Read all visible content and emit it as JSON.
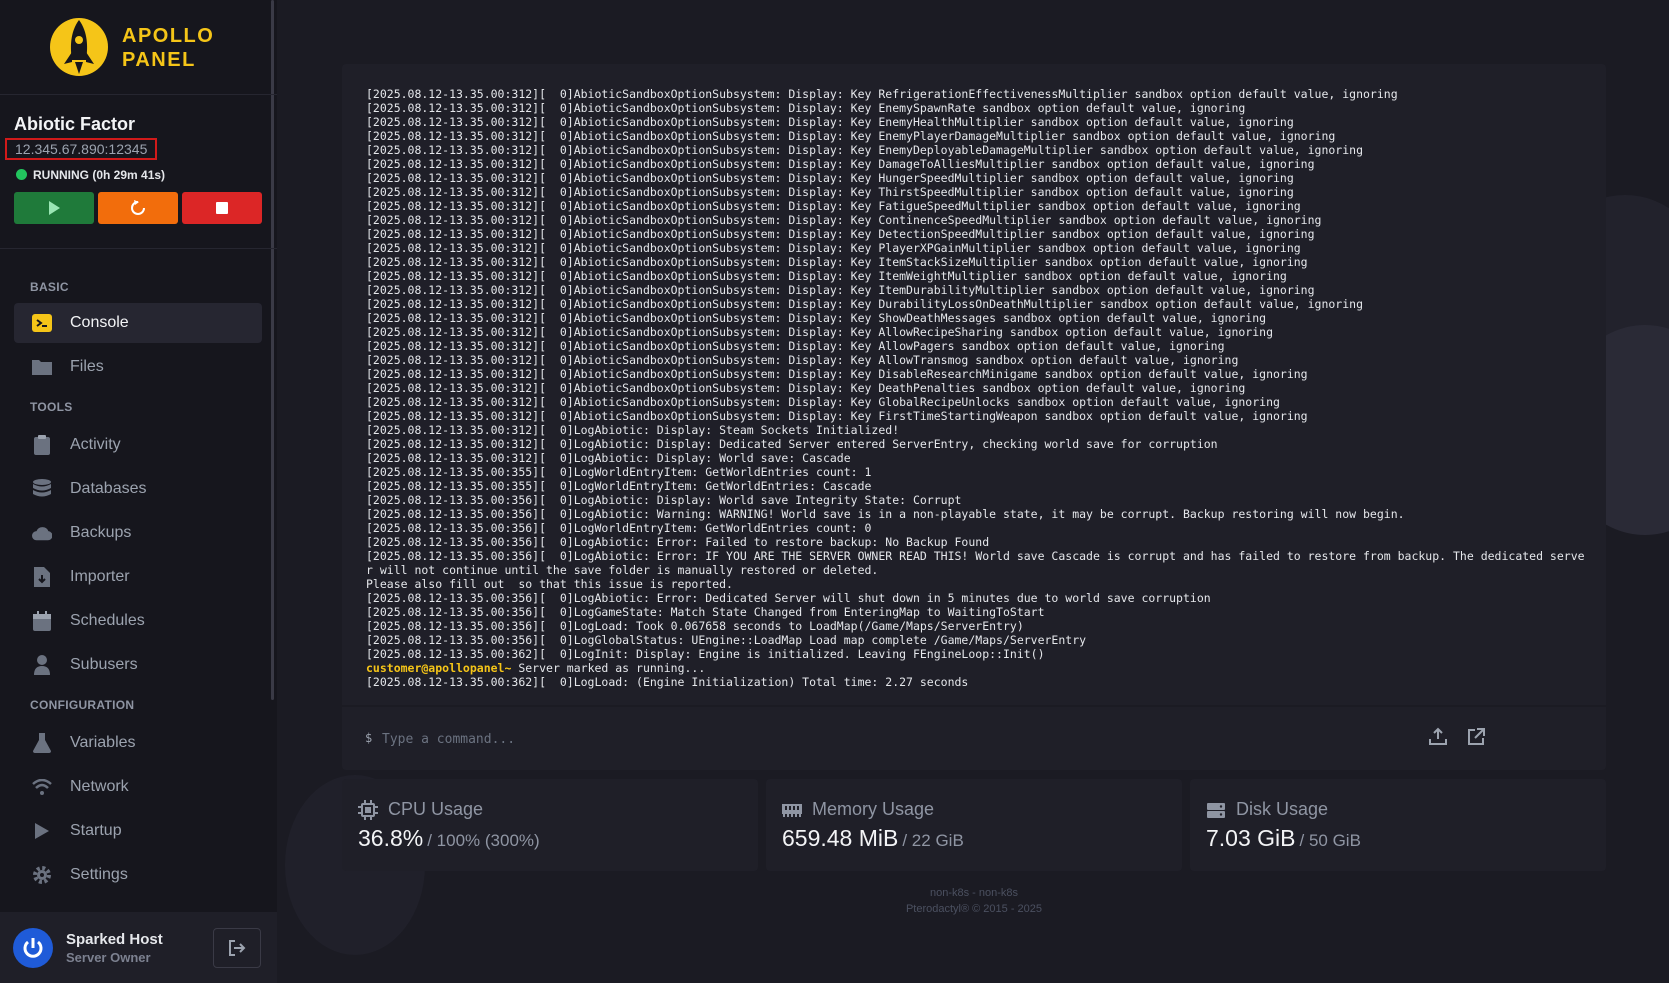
{
  "brand": {
    "line1": "APOLLO",
    "line2": "PANEL"
  },
  "server": {
    "name": "Abiotic Factor",
    "address": "12.345.67.890:12345",
    "status": "RUNNING (0h 29m 41s)"
  },
  "power_buttons": {
    "start": "play-icon",
    "restart": "restart-icon",
    "stop": "stop-icon"
  },
  "nav": {
    "basic_label": "BASIC",
    "tools_label": "TOOLS",
    "config_label": "CONFIGURATION",
    "items": [
      {
        "label": "Console",
        "icon": "console-icon"
      },
      {
        "label": "Files",
        "icon": "folder-icon"
      },
      {
        "label": "Activity",
        "icon": "clipboard-icon"
      },
      {
        "label": "Databases",
        "icon": "database-icon"
      },
      {
        "label": "Backups",
        "icon": "cloud-icon"
      },
      {
        "label": "Importer",
        "icon": "file-import-icon"
      },
      {
        "label": "Schedules",
        "icon": "calendar-icon"
      },
      {
        "label": "Subusers",
        "icon": "user-icon"
      },
      {
        "label": "Variables",
        "icon": "flask-icon"
      },
      {
        "label": "Network",
        "icon": "wifi-icon"
      },
      {
        "label": "Startup",
        "icon": "play-icon"
      },
      {
        "label": "Settings",
        "icon": "gear-icon"
      }
    ]
  },
  "user": {
    "name": "Sparked Host",
    "role": "Server Owner"
  },
  "console": {
    "lines": [
      "[2025.08.12-13.35.00:312][  0]AbioticSandboxOptionSubsystem: Display: Key RefrigerationEffectivenessMultiplier sandbox option default value, ignoring",
      "[2025.08.12-13.35.00:312][  0]AbioticSandboxOptionSubsystem: Display: Key EnemySpawnRate sandbox option default value, ignoring",
      "[2025.08.12-13.35.00:312][  0]AbioticSandboxOptionSubsystem: Display: Key EnemyHealthMultiplier sandbox option default value, ignoring",
      "[2025.08.12-13.35.00:312][  0]AbioticSandboxOptionSubsystem: Display: Key EnemyPlayerDamageMultiplier sandbox option default value, ignoring",
      "[2025.08.12-13.35.00:312][  0]AbioticSandboxOptionSubsystem: Display: Key EnemyDeployableDamageMultiplier sandbox option default value, ignoring",
      "[2025.08.12-13.35.00:312][  0]AbioticSandboxOptionSubsystem: Display: Key DamageToAlliesMultiplier sandbox option default value, ignoring",
      "[2025.08.12-13.35.00:312][  0]AbioticSandboxOptionSubsystem: Display: Key HungerSpeedMultiplier sandbox option default value, ignoring",
      "[2025.08.12-13.35.00:312][  0]AbioticSandboxOptionSubsystem: Display: Key ThirstSpeedMultiplier sandbox option default value, ignoring",
      "[2025.08.12-13.35.00:312][  0]AbioticSandboxOptionSubsystem: Display: Key FatigueSpeedMultiplier sandbox option default value, ignoring",
      "[2025.08.12-13.35.00:312][  0]AbioticSandboxOptionSubsystem: Display: Key ContinenceSpeedMultiplier sandbox option default value, ignoring",
      "[2025.08.12-13.35.00:312][  0]AbioticSandboxOptionSubsystem: Display: Key DetectionSpeedMultiplier sandbox option default value, ignoring",
      "[2025.08.12-13.35.00:312][  0]AbioticSandboxOptionSubsystem: Display: Key PlayerXPGainMultiplier sandbox option default value, ignoring",
      "[2025.08.12-13.35.00:312][  0]AbioticSandboxOptionSubsystem: Display: Key ItemStackSizeMultiplier sandbox option default value, ignoring",
      "[2025.08.12-13.35.00:312][  0]AbioticSandboxOptionSubsystem: Display: Key ItemWeightMultiplier sandbox option default value, ignoring",
      "[2025.08.12-13.35.00:312][  0]AbioticSandboxOptionSubsystem: Display: Key ItemDurabilityMultiplier sandbox option default value, ignoring",
      "[2025.08.12-13.35.00:312][  0]AbioticSandboxOptionSubsystem: Display: Key DurabilityLossOnDeathMultiplier sandbox option default value, ignoring",
      "[2025.08.12-13.35.00:312][  0]AbioticSandboxOptionSubsystem: Display: Key ShowDeathMessages sandbox option default value, ignoring",
      "[2025.08.12-13.35.00:312][  0]AbioticSandboxOptionSubsystem: Display: Key AllowRecipeSharing sandbox option default value, ignoring",
      "[2025.08.12-13.35.00:312][  0]AbioticSandboxOptionSubsystem: Display: Key AllowPagers sandbox option default value, ignoring",
      "[2025.08.12-13.35.00:312][  0]AbioticSandboxOptionSubsystem: Display: Key AllowTransmog sandbox option default value, ignoring",
      "[2025.08.12-13.35.00:312][  0]AbioticSandboxOptionSubsystem: Display: Key DisableResearchMinigame sandbox option default value, ignoring",
      "[2025.08.12-13.35.00:312][  0]AbioticSandboxOptionSubsystem: Display: Key DeathPenalties sandbox option default value, ignoring",
      "[2025.08.12-13.35.00:312][  0]AbioticSandboxOptionSubsystem: Display: Key GlobalRecipeUnlocks sandbox option default value, ignoring",
      "[2025.08.12-13.35.00:312][  0]AbioticSandboxOptionSubsystem: Display: Key FirstTimeStartingWeapon sandbox option default value, ignoring",
      "[2025.08.12-13.35.00:312][  0]LogAbiotic: Display: Steam Sockets Initialized!",
      "[2025.08.12-13.35.00:312][  0]LogAbiotic: Display: Dedicated Server entered ServerEntry, checking world save for corruption",
      "[2025.08.12-13.35.00:312][  0]LogAbiotic: Display: World save: Cascade",
      "[2025.08.12-13.35.00:355][  0]LogWorldEntryItem: GetWorldEntries count: 1",
      "[2025.08.12-13.35.00:355][  0]LogWorldEntryItem: GetWorldEntries: Cascade",
      "[2025.08.12-13.35.00:356][  0]LogAbiotic: Display: World save Integrity State: Corrupt",
      "[2025.08.12-13.35.00:356][  0]LogAbiotic: Warning: WARNING! World save is in a non-playable state, it may be corrupt. Backup restoring will now begin.",
      "[2025.08.12-13.35.00:356][  0]LogWorldEntryItem: GetWorldEntries count: 0",
      "[2025.08.12-13.35.00:356][  0]LogAbiotic: Error: Failed to restore backup: No Backup Found",
      "[2025.08.12-13.35.00:356][  0]LogAbiotic: Error: IF YOU ARE THE SERVER OWNER READ THIS! World save Cascade is corrupt and has failed to restore from backup. The dedicated server will not continue until the save folder is manually restored or deleted.",
      "Please also fill out  so that this issue is reported.",
      "[2025.08.12-13.35.00:356][  0]LogAbiotic: Error: Dedicated Server will shut down in 5 minutes due to world save corruption",
      "[2025.08.12-13.35.00:356][  0]LogGameState: Match State Changed from EnteringMap to WaitingToStart",
      "[2025.08.12-13.35.00:356][  0]LogLoad: Took 0.067658 seconds to LoadMap(/Game/Maps/ServerEntry)",
      "[2025.08.12-13.35.00:356][  0]LogGlobalStatus: UEngine::LoadMap Load map complete /Game/Maps/ServerEntry",
      "[2025.08.12-13.35.00:362][  0]LogInit: Display: Engine is initialized. Leaving FEngineLoop::Init()"
    ],
    "prompt_user": "customer@apollopanel~",
    "prompt_text": " Server marked as running...",
    "last_line": "[2025.08.12-13.35.00:362][  0]LogLoad: (Engine Initialization) Total time: 2.27 seconds"
  },
  "command": {
    "prefix": "$",
    "placeholder": "Type a command...",
    "value": ""
  },
  "stats": {
    "cpu": {
      "title": "CPU Usage",
      "value": "36.8%",
      "max": "/ 100% (300%)",
      "icon": "cpu-icon"
    },
    "memory": {
      "title": "Memory Usage",
      "value": "659.48 MiB",
      "max": "/ 22 GiB",
      "icon": "memory-icon"
    },
    "disk": {
      "title": "Disk Usage",
      "value": "7.03 GiB",
      "max": "/ 50 GiB",
      "icon": "hdd-icon"
    }
  },
  "footer": {
    "line1": "non-k8s - non-k8s",
    "line2": "Pterodactyl® © 2015 - 2025"
  },
  "colors": {
    "accent": "#f5c518",
    "start": "#1f7a3a",
    "restart": "#f26d0c",
    "stop": "#dc2626",
    "running": "#22c55e"
  }
}
